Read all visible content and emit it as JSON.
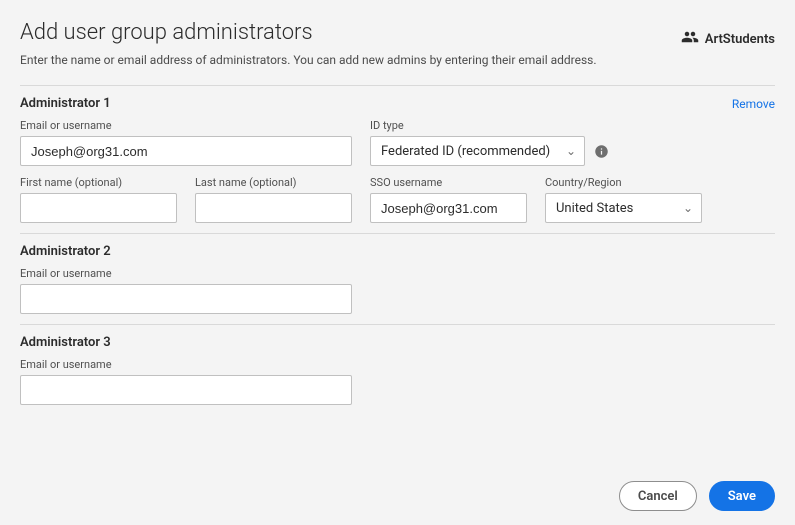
{
  "header": {
    "title": "Add user group administrators",
    "group_name": "ArtStudents",
    "subtitle": "Enter the name or email address of administrators. You can add new admins by entering their email address."
  },
  "labels": {
    "email_or_username": "Email or username",
    "id_type": "ID type",
    "first_name": "First name (optional)",
    "last_name": "Last name (optional)",
    "sso_username": "SSO username",
    "country_region": "Country/Region",
    "remove": "Remove"
  },
  "admins": {
    "a1": {
      "title": "Administrator 1",
      "email_value": "Joseph@org31.com",
      "id_type_value": "Federated ID (recommended)",
      "first_name_value": "",
      "last_name_value": "",
      "sso_value": "Joseph@org31.com",
      "country_value": "United States"
    },
    "a2": {
      "title": "Administrator 2",
      "email_value": ""
    },
    "a3": {
      "title": "Administrator 3",
      "email_value": ""
    }
  },
  "footer": {
    "cancel": "Cancel",
    "save": "Save"
  }
}
